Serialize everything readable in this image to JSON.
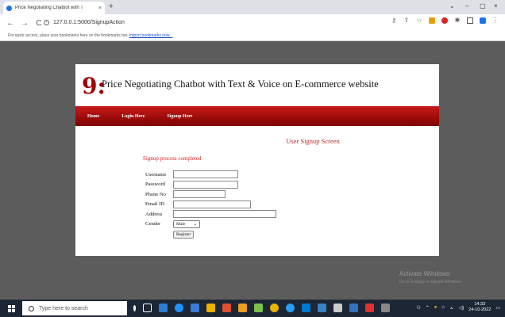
{
  "browser": {
    "tab_title": "Price Negotiating Chatbot with T",
    "url": "127.0.0.1:5000/SignupAction",
    "new_tab_glyph": "+",
    "tab_close_glyph": "×",
    "bookmarks_hint": "For quick access, place your bookmarks here on the bookmarks bar.",
    "bookmarks_link": "Import bookmarks now...",
    "window_controls": [
      "⌄",
      "–",
      "▢",
      "×"
    ],
    "nav_back": "←",
    "nav_forward": "→",
    "nav_reload": "C"
  },
  "site": {
    "logo_glyph": "9:",
    "title": "Price Negotiating Chatbot with Text & Voice on E-commerce website",
    "nav": [
      "Home",
      "Login Here",
      "Signup Here"
    ]
  },
  "form": {
    "title": "User Signup Screen",
    "status": "Signup process completed",
    "labels": {
      "username": "Username",
      "password": "Password",
      "phone": "Phone No",
      "email": "Email ID",
      "address": "Address",
      "gender": "Gender"
    },
    "values": {
      "username": "",
      "password": "",
      "phone": "",
      "email": "",
      "address": ""
    },
    "gender_selected": "Male",
    "register_label": "Register"
  },
  "watermark": {
    "title": "Activate Windows",
    "sub": "Go to Settings to activate Windows."
  },
  "taskbar": {
    "search_placeholder": "Type here to search",
    "time": "14:33",
    "date": "24-10-2022"
  },
  "colors": {
    "accent_red": "#a00000",
    "nav_red": "#9a0a0a",
    "title_red": "#b52a2a"
  }
}
